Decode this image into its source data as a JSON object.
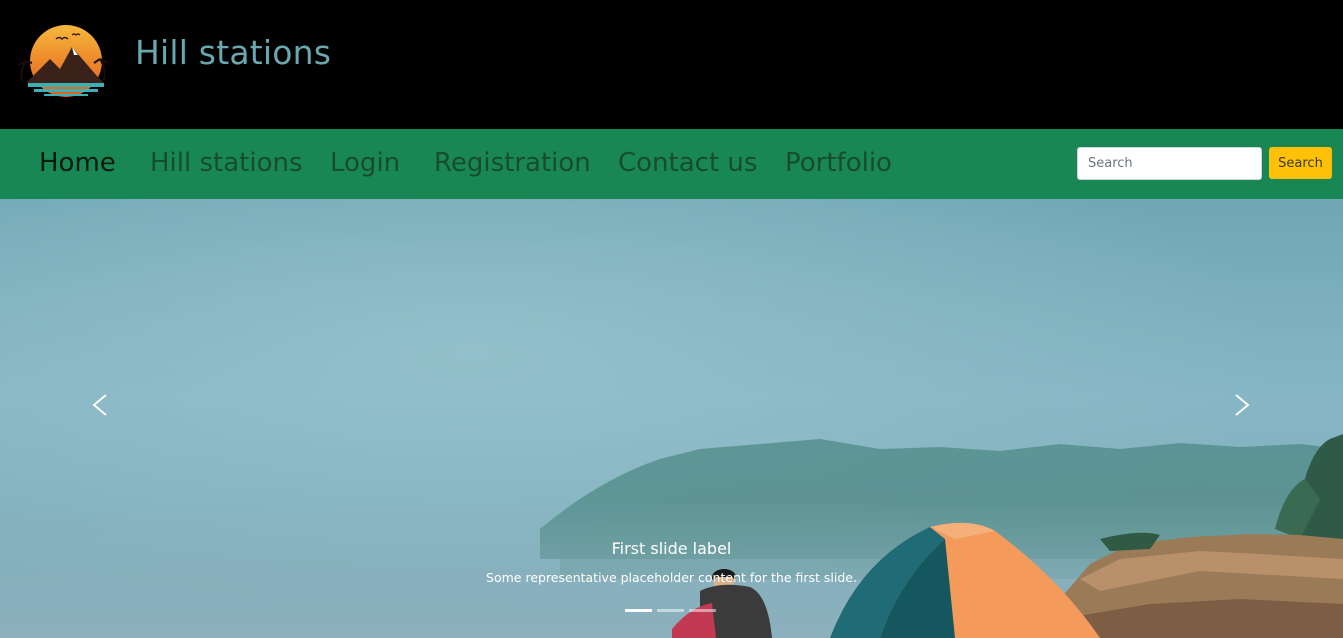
{
  "header": {
    "brand": "Hill stations",
    "logo_icon": "mountain-sunset-logo"
  },
  "nav": {
    "items": [
      {
        "label": "Home",
        "active": true
      },
      {
        "label": "Hill stations"
      },
      {
        "label": "Login"
      },
      {
        "label": "Registration"
      },
      {
        "label": "Contact us"
      },
      {
        "label": "Portfolio"
      }
    ]
  },
  "search": {
    "placeholder": "Search",
    "value": "",
    "button_label": "Search"
  },
  "carousel": {
    "caption_title": "First slide label",
    "caption_text": "Some representative placeholder content for the first slide.",
    "prev_icon": "chevron-left-icon",
    "next_icon": "chevron-right-icon",
    "slide_count": 3,
    "active_slide": 1
  },
  "colors": {
    "navbar": "#198754",
    "search_button": "#ffc107",
    "brand_text": "#6aa8b0"
  }
}
